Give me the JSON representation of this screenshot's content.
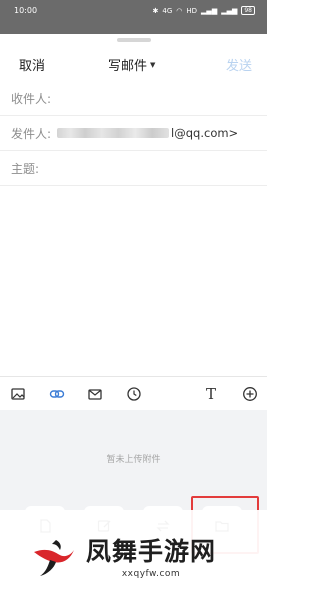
{
  "status_bar": {
    "time": "10:00",
    "indicators": [
      "bluetooth-icon",
      "4G",
      "wifi-icon",
      "HD",
      "signal-icon",
      "signal-icon"
    ],
    "battery": "98"
  },
  "header": {
    "cancel_label": "取消",
    "title": "写邮件",
    "send_label": "发送"
  },
  "fields": {
    "to_label": "收件人:",
    "from_label": "发件人:",
    "from_value_suffix": "l@qq.com>",
    "subject_label": "主题:"
  },
  "toolbar": {
    "items": [
      "image-icon",
      "link-icon",
      "mail-icon",
      "clock-icon",
      "text-format-icon",
      "add-icon"
    ],
    "text_glyph": "T"
  },
  "attachments": {
    "empty_hint": "暂未上传附件",
    "tiles": [
      "document-icon",
      "edit-note-icon",
      "transfer-icon",
      "folder-icon"
    ]
  },
  "watermark": {
    "title": "凤舞手游网",
    "url": "xxqyfw.com"
  },
  "colors": {
    "send_disabled": "#b9d3f0",
    "link_accent": "#3a7bd5",
    "highlight": "#e33b3b"
  }
}
